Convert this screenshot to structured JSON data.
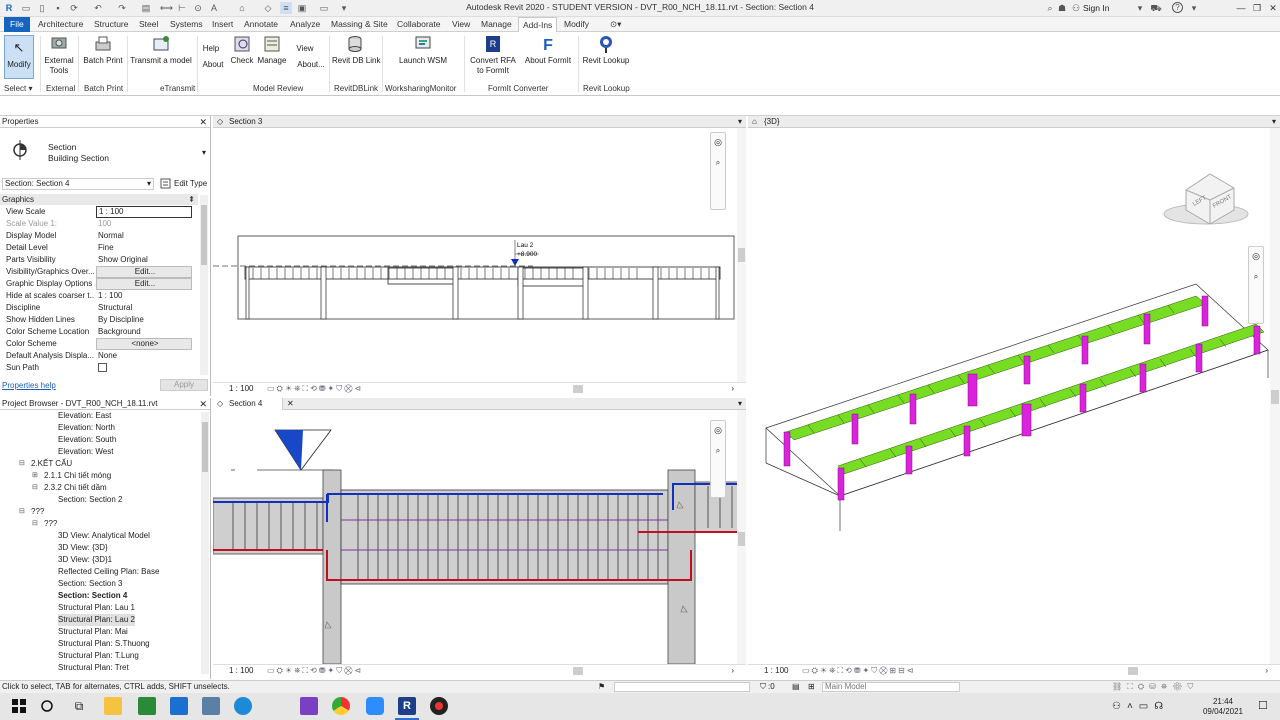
{
  "window": {
    "title": "Autodesk Revit 2020 - STUDENT VERSION - DVT_R00_NCH_18.11.rvt - Section: Section 4",
    "sign_in": "Sign In",
    "help": "?"
  },
  "tabs": [
    "File",
    "Architecture",
    "Structure",
    "Steel",
    "Systems",
    "Insert",
    "Annotate",
    "Analyze",
    "Massing & Site",
    "Collaborate",
    "View",
    "Manage",
    "Add-Ins",
    "Modify"
  ],
  "active_tab": "Add-Ins",
  "ribbon": {
    "modify": "Modify",
    "select": "Select",
    "external_tools": "External Tools",
    "batch_print": "Batch Print",
    "transmit": "Transmit a model",
    "help": "Help",
    "about": "About",
    "check": "Check",
    "manage": "Manage",
    "view": "View",
    "about_dots": "About...",
    "revit_db_link": "Revit DB Link",
    "launch_wsm": "Launch WSM",
    "convert_rfa": "Convert RFA to FormIt",
    "about_formit": "About FormIt",
    "revit_lookup": "Revit Lookup",
    "panels": {
      "select": "Select",
      "external": "External",
      "batch_print": "Batch Print",
      "etransmit": "eTransmit",
      "model_review": "Model Review",
      "revitdblink": "RevitDBLink",
      "worksharing": "WorksharingMonitor",
      "formit": "FormIt Converter",
      "revit_lookup": "Revit Lookup"
    }
  },
  "properties": {
    "header": "Properties",
    "type_line1": "Section",
    "type_line2": "Building Section",
    "selector": "Section: Section 4",
    "edit_type": "Edit Type",
    "group": "Graphics",
    "rows": [
      {
        "k": "View Scale",
        "v": "1 : 100",
        "kind": "box"
      },
      {
        "k": "Scale Value    1:",
        "v": "100",
        "kind": "grey"
      },
      {
        "k": "Display Model",
        "v": "Normal",
        "kind": "text"
      },
      {
        "k": "Detail Level",
        "v": "Fine",
        "kind": "text"
      },
      {
        "k": "Parts Visibility",
        "v": "Show Original",
        "kind": "text"
      },
      {
        "k": "Visibility/Graphics Over...",
        "v": "Edit...",
        "kind": "btn"
      },
      {
        "k": "Graphic Display Options",
        "v": "Edit...",
        "kind": "btn"
      },
      {
        "k": "Hide at scales coarser t...",
        "v": "1 : 100",
        "kind": "text"
      },
      {
        "k": "Discipline",
        "v": "Structural",
        "kind": "text"
      },
      {
        "k": "Show Hidden Lines",
        "v": "By Discipline",
        "kind": "text"
      },
      {
        "k": "Color Scheme Location",
        "v": "Background",
        "kind": "text"
      },
      {
        "k": "Color Scheme",
        "v": "<none>",
        "kind": "btn"
      },
      {
        "k": "Default Analysis Displa...",
        "v": "None",
        "kind": "text"
      },
      {
        "k": "Sun Path",
        "v": "",
        "kind": "check"
      }
    ],
    "help_link": "Properties help",
    "apply": "Apply"
  },
  "browser": {
    "header": "Project Browser - DVT_R00_NCH_18.11.rvt",
    "items": [
      {
        "t": "Elevation: East",
        "l": 58,
        "s": ""
      },
      {
        "t": "Elevation: North",
        "l": 58,
        "s": ""
      },
      {
        "t": "Elevation: South",
        "l": 58,
        "s": ""
      },
      {
        "t": "Elevation: West",
        "l": 58,
        "s": ""
      },
      {
        "t": "2.KẾT CẤU",
        "l": 31,
        "s": "exp"
      },
      {
        "t": "2.1.1 Chi tiết móng",
        "l": 44,
        "s": "col"
      },
      {
        "t": "2.3.2 Chi tiết dầm",
        "l": 44,
        "s": "exp"
      },
      {
        "t": "Section: Section 2",
        "l": 58,
        "s": ""
      },
      {
        "t": "???",
        "l": 31,
        "s": "exp"
      },
      {
        "t": "???",
        "l": 44,
        "s": "exp"
      },
      {
        "t": "3D View: Analytical Model",
        "l": 58,
        "s": ""
      },
      {
        "t": "3D View: {3D}",
        "l": 58,
        "s": ""
      },
      {
        "t": "3D View: {3D}1",
        "l": 58,
        "s": ""
      },
      {
        "t": "Reflected Ceiling Plan: Base",
        "l": 58,
        "s": ""
      },
      {
        "t": "Section: Section 3",
        "l": 58,
        "s": ""
      },
      {
        "t": "Section: Section 4",
        "l": 58,
        "s": "bold"
      },
      {
        "t": "Structural Plan: Lau 1",
        "l": 58,
        "s": ""
      },
      {
        "t": "Structural Plan: Lau 2",
        "l": 58,
        "s": "sel"
      },
      {
        "t": "Structural Plan: Mai",
        "l": 58,
        "s": ""
      },
      {
        "t": "Structural Plan: S.Thuong",
        "l": 58,
        "s": ""
      },
      {
        "t": "Structural Plan: T.Lung",
        "l": 58,
        "s": ""
      },
      {
        "t": "Structural Plan: Tret",
        "l": 58,
        "s": ""
      }
    ]
  },
  "views": {
    "section3_tab": "Section 3",
    "section4_tab": "Section 4",
    "view3d_tab": "{3D}",
    "scale": "1 : 100",
    "level_name": "Lau 2",
    "level_elev": "+8.900",
    "viewcube_top": "LEFT",
    "viewcube_front": "FRONT"
  },
  "status": {
    "hint": "Click to select, TAB for alternates, CTRL adds, SHIFT unselects.",
    "zero": ":0",
    "model": "Main Model"
  },
  "taskbar": {
    "time": "21:44",
    "date": "09/04/2021"
  },
  "colors": {
    "accent": "#1565c0",
    "beam": "#66cc22",
    "column": "#dd22dd",
    "rebar_blue": "#1030c0",
    "rebar_red": "#c01020"
  }
}
